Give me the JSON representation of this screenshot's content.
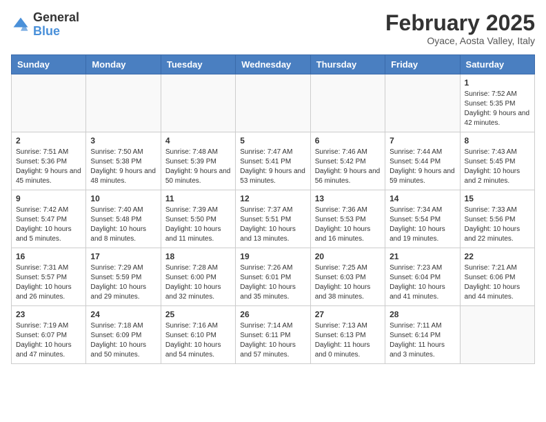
{
  "header": {
    "logo_general": "General",
    "logo_blue": "Blue",
    "month_title": "February 2025",
    "location": "Oyace, Aosta Valley, Italy"
  },
  "days_of_week": [
    "Sunday",
    "Monday",
    "Tuesday",
    "Wednesday",
    "Thursday",
    "Friday",
    "Saturday"
  ],
  "weeks": [
    [
      {
        "day": "",
        "info": ""
      },
      {
        "day": "",
        "info": ""
      },
      {
        "day": "",
        "info": ""
      },
      {
        "day": "",
        "info": ""
      },
      {
        "day": "",
        "info": ""
      },
      {
        "day": "",
        "info": ""
      },
      {
        "day": "1",
        "info": "Sunrise: 7:52 AM\nSunset: 5:35 PM\nDaylight: 9 hours and 42 minutes."
      }
    ],
    [
      {
        "day": "2",
        "info": "Sunrise: 7:51 AM\nSunset: 5:36 PM\nDaylight: 9 hours and 45 minutes."
      },
      {
        "day": "3",
        "info": "Sunrise: 7:50 AM\nSunset: 5:38 PM\nDaylight: 9 hours and 48 minutes."
      },
      {
        "day": "4",
        "info": "Sunrise: 7:48 AM\nSunset: 5:39 PM\nDaylight: 9 hours and 50 minutes."
      },
      {
        "day": "5",
        "info": "Sunrise: 7:47 AM\nSunset: 5:41 PM\nDaylight: 9 hours and 53 minutes."
      },
      {
        "day": "6",
        "info": "Sunrise: 7:46 AM\nSunset: 5:42 PM\nDaylight: 9 hours and 56 minutes."
      },
      {
        "day": "7",
        "info": "Sunrise: 7:44 AM\nSunset: 5:44 PM\nDaylight: 9 hours and 59 minutes."
      },
      {
        "day": "8",
        "info": "Sunrise: 7:43 AM\nSunset: 5:45 PM\nDaylight: 10 hours and 2 minutes."
      }
    ],
    [
      {
        "day": "9",
        "info": "Sunrise: 7:42 AM\nSunset: 5:47 PM\nDaylight: 10 hours and 5 minutes."
      },
      {
        "day": "10",
        "info": "Sunrise: 7:40 AM\nSunset: 5:48 PM\nDaylight: 10 hours and 8 minutes."
      },
      {
        "day": "11",
        "info": "Sunrise: 7:39 AM\nSunset: 5:50 PM\nDaylight: 10 hours and 11 minutes."
      },
      {
        "day": "12",
        "info": "Sunrise: 7:37 AM\nSunset: 5:51 PM\nDaylight: 10 hours and 13 minutes."
      },
      {
        "day": "13",
        "info": "Sunrise: 7:36 AM\nSunset: 5:53 PM\nDaylight: 10 hours and 16 minutes."
      },
      {
        "day": "14",
        "info": "Sunrise: 7:34 AM\nSunset: 5:54 PM\nDaylight: 10 hours and 19 minutes."
      },
      {
        "day": "15",
        "info": "Sunrise: 7:33 AM\nSunset: 5:56 PM\nDaylight: 10 hours and 22 minutes."
      }
    ],
    [
      {
        "day": "16",
        "info": "Sunrise: 7:31 AM\nSunset: 5:57 PM\nDaylight: 10 hours and 26 minutes."
      },
      {
        "day": "17",
        "info": "Sunrise: 7:29 AM\nSunset: 5:59 PM\nDaylight: 10 hours and 29 minutes."
      },
      {
        "day": "18",
        "info": "Sunrise: 7:28 AM\nSunset: 6:00 PM\nDaylight: 10 hours and 32 minutes."
      },
      {
        "day": "19",
        "info": "Sunrise: 7:26 AM\nSunset: 6:01 PM\nDaylight: 10 hours and 35 minutes."
      },
      {
        "day": "20",
        "info": "Sunrise: 7:25 AM\nSunset: 6:03 PM\nDaylight: 10 hours and 38 minutes."
      },
      {
        "day": "21",
        "info": "Sunrise: 7:23 AM\nSunset: 6:04 PM\nDaylight: 10 hours and 41 minutes."
      },
      {
        "day": "22",
        "info": "Sunrise: 7:21 AM\nSunset: 6:06 PM\nDaylight: 10 hours and 44 minutes."
      }
    ],
    [
      {
        "day": "23",
        "info": "Sunrise: 7:19 AM\nSunset: 6:07 PM\nDaylight: 10 hours and 47 minutes."
      },
      {
        "day": "24",
        "info": "Sunrise: 7:18 AM\nSunset: 6:09 PM\nDaylight: 10 hours and 50 minutes."
      },
      {
        "day": "25",
        "info": "Sunrise: 7:16 AM\nSunset: 6:10 PM\nDaylight: 10 hours and 54 minutes."
      },
      {
        "day": "26",
        "info": "Sunrise: 7:14 AM\nSunset: 6:11 PM\nDaylight: 10 hours and 57 minutes."
      },
      {
        "day": "27",
        "info": "Sunrise: 7:13 AM\nSunset: 6:13 PM\nDaylight: 11 hours and 0 minutes."
      },
      {
        "day": "28",
        "info": "Sunrise: 7:11 AM\nSunset: 6:14 PM\nDaylight: 11 hours and 3 minutes."
      },
      {
        "day": "",
        "info": ""
      }
    ]
  ]
}
